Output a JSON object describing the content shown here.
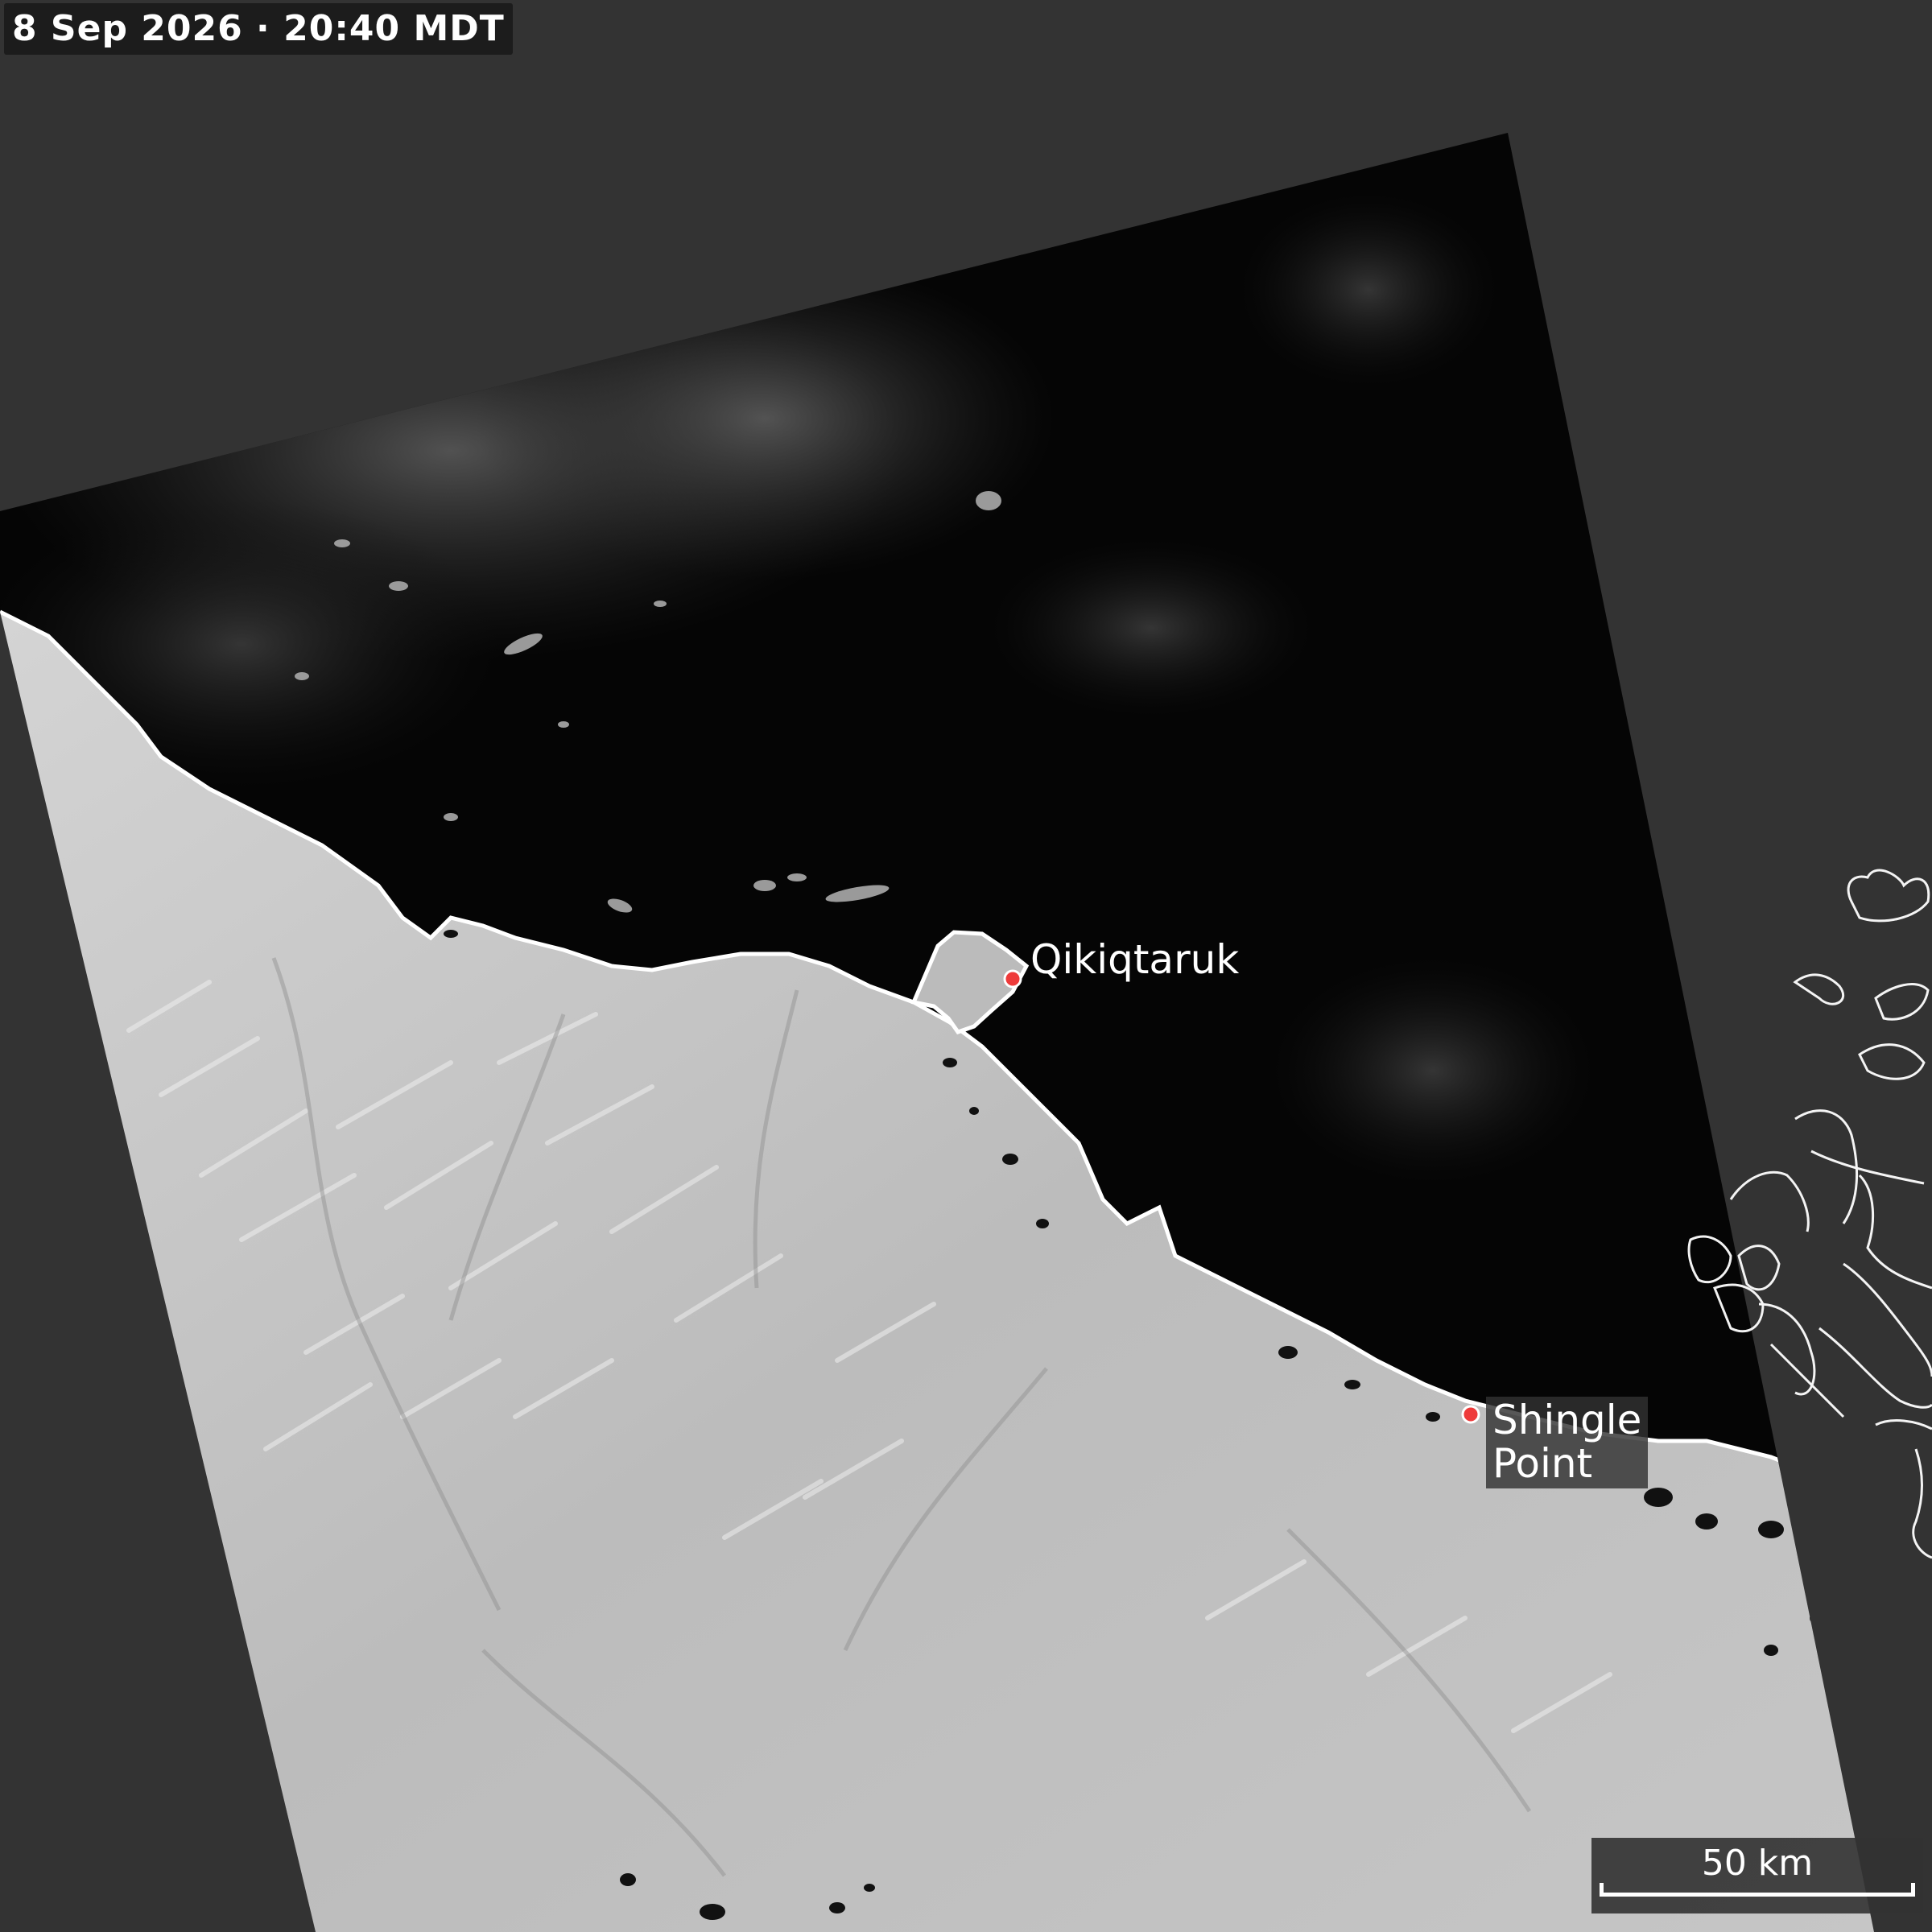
{
  "timestamp": "8 Sep 2026 · 20:40 MDT",
  "places": {
    "qikiqtaruk": {
      "name": "Qikiqtaruk"
    },
    "shingle_point": {
      "line1": "Shingle",
      "line2": "Point"
    }
  },
  "scale_bar": {
    "label": "50 km"
  },
  "colors": {
    "background": "#333333",
    "sea": "#050505",
    "land": "#bdbdbd",
    "coastline": "#ffffff",
    "marker": "#ee3b3b"
  }
}
